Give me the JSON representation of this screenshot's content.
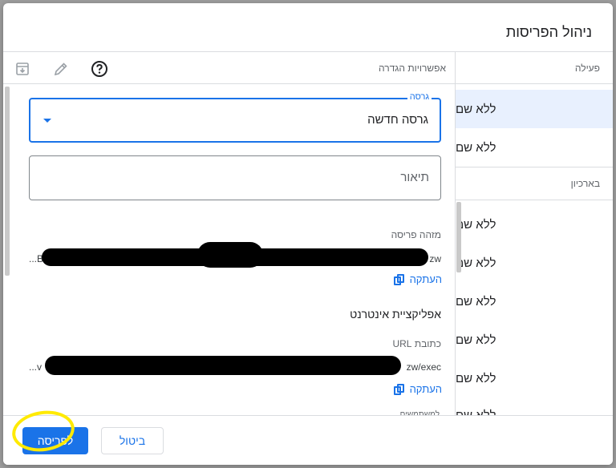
{
  "dialog": {
    "title": "ניהול הפריסות"
  },
  "deployments": {
    "active_label": "פעילה",
    "active_items": [
      "ללא שם",
      "ללא שם"
    ],
    "archived_label": "בארכיון",
    "archived_items": [
      "ללא שם",
      "ללא שם",
      "ללא שם",
      "ללא שם",
      "ללא שם",
      "ללא שם"
    ]
  },
  "config": {
    "label": "אפשרויות הגדרה",
    "version_label": "גרסה",
    "version_value": "גרסה חדשה",
    "description_placeholder": "תיאור",
    "deployment_id_label": "מזהה פריסה",
    "deployment_id_start": "...B",
    "deployment_id_end": "zw",
    "copy_label": "העתקה",
    "webapp_label": "אפליקציית אינטרנט",
    "url_label": "כתובת URL",
    "url_start": "...v",
    "url_end": "zw/exec",
    "cut_off_text": "למשתמשים"
  },
  "icons": {
    "archive": "archive-icon",
    "edit": "pencil-icon",
    "help": "help-icon",
    "copy": "copy-icon"
  },
  "footer": {
    "deploy_label": "לפריסה",
    "cancel_label": "ביטול"
  },
  "colors": {
    "accent": "#1a73e8",
    "selected_bg": "#e8f0fe",
    "highlight": "#ffea00"
  }
}
